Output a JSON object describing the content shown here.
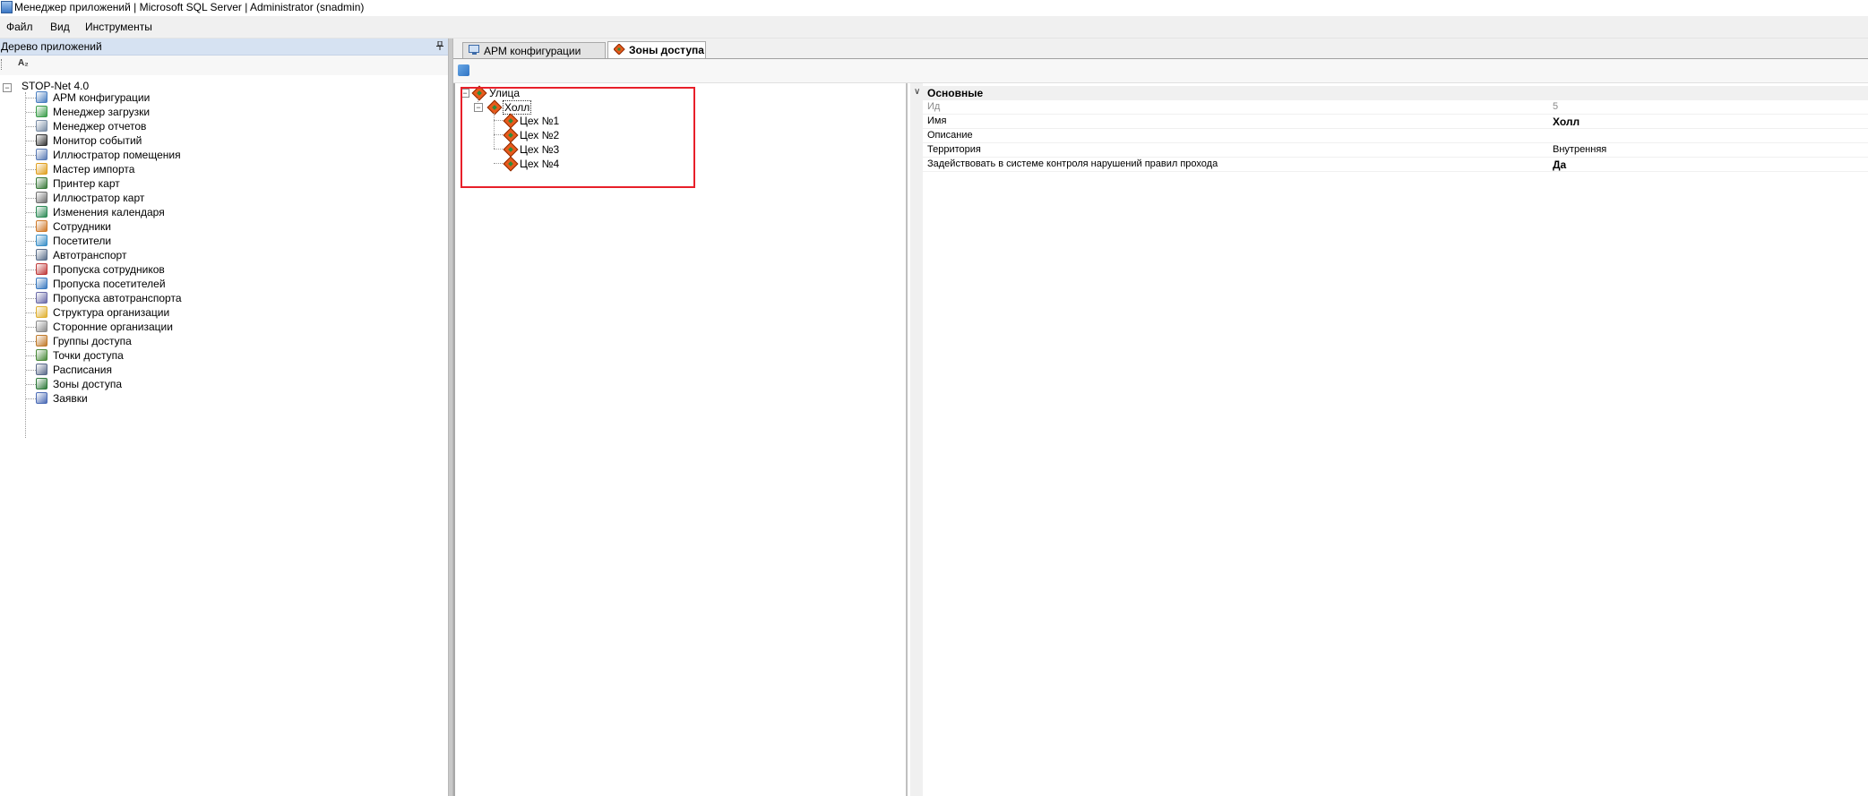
{
  "window": {
    "title": "Менеджер приложений | Microsoft SQL Server | Administrator  (snadmin)"
  },
  "menu": {
    "items": [
      "Файл",
      "Вид",
      "Инструменты"
    ]
  },
  "left_panel": {
    "title": "Дерево приложений",
    "sort_label": "A₂",
    "root": "STOP-Net 4.0",
    "items": [
      {
        "label": "АРМ конфигурации",
        "icon": "config-icon",
        "color": "#4a7fc1"
      },
      {
        "label": "Менеджер загрузки",
        "icon": "download-icon",
        "color": "#3b9d4a"
      },
      {
        "label": "Менеджер отчетов",
        "icon": "report-icon",
        "color": "#7a8da6"
      },
      {
        "label": "Монитор событий",
        "icon": "eye-icon",
        "color": "#333333"
      },
      {
        "label": "Иллюстратор помещения",
        "icon": "building-icon",
        "color": "#5a7bb5"
      },
      {
        "label": "Мастер импорта",
        "icon": "import-icon",
        "color": "#e0a020"
      },
      {
        "label": "Принтер карт",
        "icon": "printer-icon",
        "color": "#3a7a3a"
      },
      {
        "label": "Иллюстратор карт",
        "icon": "card-icon",
        "color": "#6e6e6e"
      },
      {
        "label": "Изменения календаря",
        "icon": "calendar-icon",
        "color": "#2e8b57"
      },
      {
        "label": "Сотрудники",
        "icon": "users-icon",
        "color": "#d07a2a"
      },
      {
        "label": "Посетители",
        "icon": "visitors-icon",
        "color": "#3a8fc7"
      },
      {
        "label": "Автотранспорт",
        "icon": "car-icon",
        "color": "#5a6e8a"
      },
      {
        "label": "Пропуска сотрудников",
        "icon": "badge-icon",
        "color": "#c03a3a"
      },
      {
        "label": "Пропуска посетителей",
        "icon": "badge-visitor-icon",
        "color": "#3a7ac0"
      },
      {
        "label": "Пропуска автотранспорта",
        "icon": "badge-car-icon",
        "color": "#6a6aa8"
      },
      {
        "label": "Структура организации",
        "icon": "structure-icon",
        "color": "#e0b030"
      },
      {
        "label": "Сторонние организации",
        "icon": "organization-icon",
        "color": "#8a8a8a"
      },
      {
        "label": "Группы доступа",
        "icon": "group-icon",
        "color": "#c07a2a"
      },
      {
        "label": "Точки доступа",
        "icon": "access-point-icon",
        "color": "#4a8a3a"
      },
      {
        "label": "Расписания",
        "icon": "clock-icon",
        "color": "#5a6a8a"
      },
      {
        "label": "Зоны доступа",
        "icon": "zone-icon",
        "color": "#2e7a3a"
      },
      {
        "label": "Заявки",
        "icon": "request-icon",
        "color": "#4a6ab5"
      }
    ]
  },
  "tabs": [
    {
      "label": "АРМ конфигурации",
      "active": false
    },
    {
      "label": "Зоны доступа",
      "active": true
    }
  ],
  "zone_tree": {
    "root": "Улица",
    "child": "Холл",
    "leaves": [
      "Цех №1",
      "Цех №2",
      "Цех №3",
      "Цех №4"
    ]
  },
  "properties": {
    "category": "Основные",
    "rows": [
      {
        "name": "Ид",
        "value": "5",
        "readonly": true,
        "bold": false
      },
      {
        "name": "Имя",
        "value": "Холл",
        "readonly": false,
        "bold": true
      },
      {
        "name": "Описание",
        "value": "",
        "readonly": false,
        "bold": false
      },
      {
        "name": "Территория",
        "value": "Внутренняя",
        "readonly": false,
        "bold": false
      },
      {
        "name": "Задействовать в системе контроля нарушений правил прохода",
        "value": "Да",
        "readonly": false,
        "bold": true
      }
    ]
  },
  "colors": {
    "highlight": "#e8202a",
    "panel_header": "#d6e2f2"
  }
}
